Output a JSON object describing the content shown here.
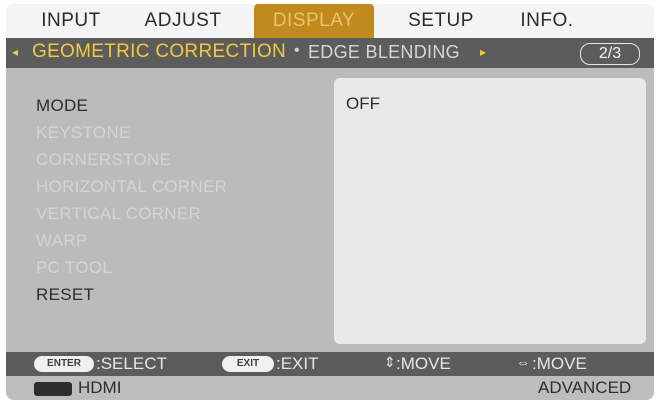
{
  "menu": {
    "tabs": [
      {
        "label": "INPUT"
      },
      {
        "label": "ADJUST"
      },
      {
        "label": "DISPLAY"
      },
      {
        "label": "SETUP"
      },
      {
        "label": "INFO."
      }
    ],
    "active_tab": "DISPLAY"
  },
  "subtabs": {
    "left_arrow": "◂",
    "active": "GEOMETRIC CORRECTION",
    "separator": "•",
    "next": "EDGE BLENDING",
    "right_arrow": "▸",
    "page": "2/3"
  },
  "items": [
    {
      "label": "MODE",
      "enabled": true
    },
    {
      "label": "KEYSTONE",
      "enabled": false
    },
    {
      "label": "CORNERSTONE",
      "enabled": false
    },
    {
      "label": "HORIZONTAL CORNER",
      "enabled": false
    },
    {
      "label": "VERTICAL CORNER",
      "enabled": false
    },
    {
      "label": "WARP",
      "enabled": false
    },
    {
      "label": "PC TOOL",
      "enabled": false
    },
    {
      "label": "RESET",
      "enabled": true
    }
  ],
  "value_panel": {
    "value": "OFF"
  },
  "help": {
    "enter_key": "ENTER",
    "select_label": ":SELECT",
    "exit_key": "EXIT",
    "exit_label": ":EXIT",
    "move_v_icon": "⇕",
    "move_v_label": ":MOVE",
    "move_h_icon": "⇔",
    "move_h_label": ":MOVE"
  },
  "status": {
    "source_icon": "hdmi-icon",
    "source": "HDMI",
    "menu_mode": "ADVANCED"
  },
  "colors": {
    "active_tab": "#c08a1e",
    "highlight_text": "#f2ca3e",
    "bar": "#5c5c5c",
    "panel": "#e9e9e9"
  }
}
